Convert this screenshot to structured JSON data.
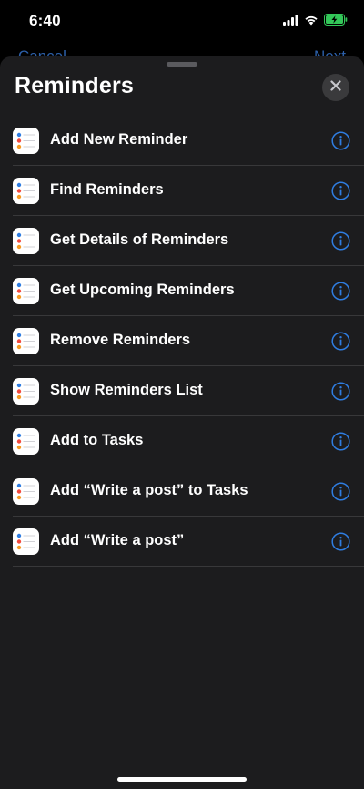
{
  "status_bar": {
    "time": "6:40",
    "icons": [
      "signal-icon",
      "wifi-icon",
      "battery-charging-icon"
    ]
  },
  "behind": {
    "left_label": "Cancel",
    "right_label": "Next"
  },
  "sheet": {
    "title": "Reminders",
    "close_icon": "close-icon",
    "items": [
      {
        "label": "Add New Reminder"
      },
      {
        "label": "Find Reminders"
      },
      {
        "label": "Get Details of Reminders"
      },
      {
        "label": "Get Upcoming Reminders"
      },
      {
        "label": "Remove Reminders"
      },
      {
        "label": "Show Reminders List"
      },
      {
        "label": "Add to Tasks"
      },
      {
        "label": "Add “Write a post” to Tasks"
      },
      {
        "label": "Add “Write a post”"
      }
    ]
  },
  "colors": {
    "sheet_background": "#1c1c1e",
    "accent": "#2f7de1",
    "battery": "#33c759"
  }
}
